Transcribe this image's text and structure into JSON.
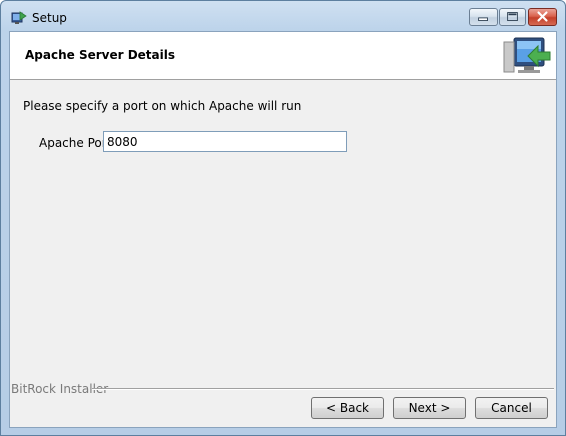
{
  "window": {
    "title": "Setup"
  },
  "header": {
    "title": "Apache Server Details"
  },
  "main": {
    "instruction": "Please specify a port on which Apache will run",
    "port_label": "Apache Port",
    "port_value": "8080"
  },
  "footer": {
    "brand": "BitRock Installer",
    "back_label": "< Back",
    "next_label": "Next >",
    "cancel_label": "Cancel"
  },
  "icons": {
    "app": "setup-app-icon",
    "header": "computer-install-arrow-icon",
    "minimize": "minimize-icon",
    "maximize": "maximize-icon",
    "close": "close-icon"
  },
  "colors": {
    "titlebar": "#bcd3ea",
    "client_bg": "#f0f0f0",
    "header_bg": "#ffffff",
    "close_button": "#c4402a",
    "arrow_green": "#4caf50"
  }
}
